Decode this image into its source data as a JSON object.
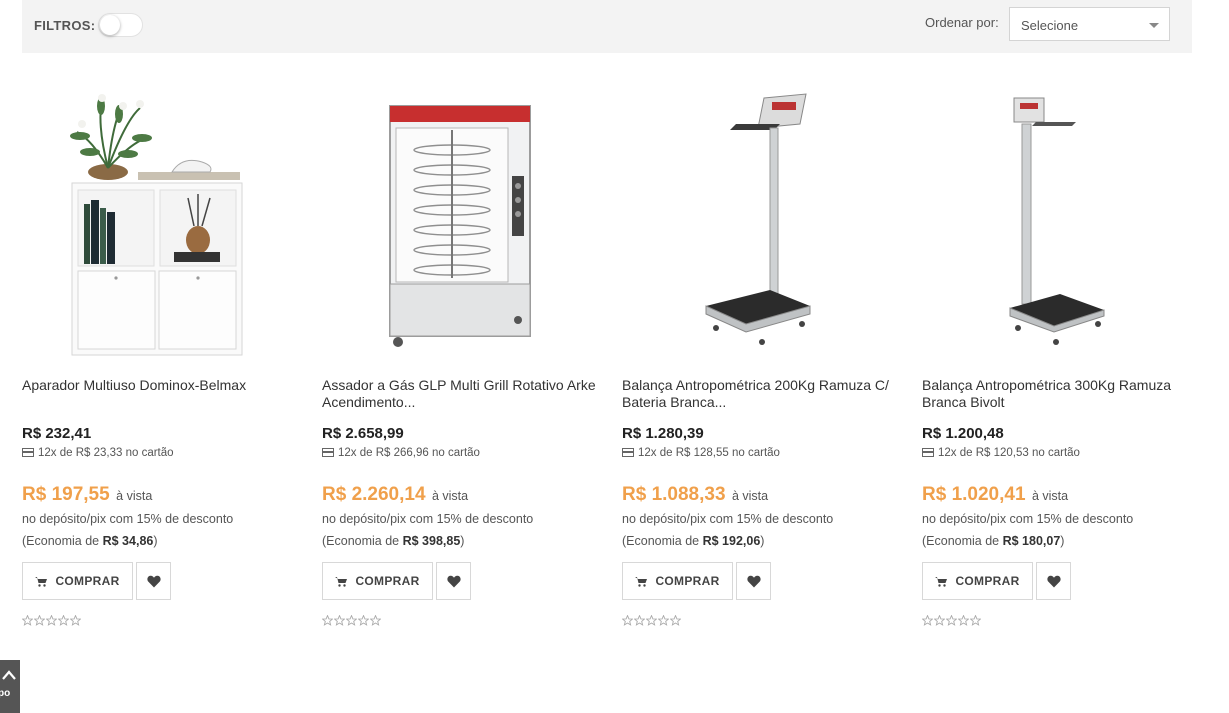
{
  "toolbar": {
    "filters_label": "FILTROS:",
    "sort_label": "Ordenar por:",
    "sort_value": "Selecione"
  },
  "products": [
    {
      "title": "Aparador Multiuso Dominox-Belmax",
      "price": "R$ 232,41",
      "installments": "12x de R$ 23,33 no cartão",
      "cash_price": "R$ 197,55",
      "cash_suffix": "à vista",
      "discount_text": "no depósito/pix com 15% de desconto",
      "economy_prefix": "(Economia de",
      "economy_value": "R$ 34,86",
      "economy_suffix": ")",
      "buy_label": "COMPRAR",
      "rating": 0
    },
    {
      "title": "Assador a Gás GLP Multi Grill Rotativo Arke Acendimento...",
      "price": "R$ 2.658,99",
      "installments": "12x de R$ 266,96 no cartão",
      "cash_price": "R$ 2.260,14",
      "cash_suffix": "à vista",
      "discount_text": "no depósito/pix com 15% de desconto",
      "economy_prefix": "(Economia de",
      "economy_value": "R$ 398,85",
      "economy_suffix": ")",
      "buy_label": "COMPRAR",
      "rating": 0
    },
    {
      "title": "Balança Antropométrica 200Kg Ramuza C/ Bateria Branca...",
      "price": "R$ 1.280,39",
      "installments": "12x de R$ 128,55 no cartão",
      "cash_price": "R$ 1.088,33",
      "cash_suffix": "à vista",
      "discount_text": "no depósito/pix com 15% de desconto",
      "economy_prefix": "(Economia de",
      "economy_value": "R$ 192,06",
      "economy_suffix": ")",
      "buy_label": "COMPRAR",
      "rating": 0
    },
    {
      "title": "Balança Antropométrica 300Kg Ramuza Branca Bivolt",
      "price": "R$ 1.200,48",
      "installments": "12x de R$ 120,53 no cartão",
      "cash_price": "R$ 1.020,41",
      "cash_suffix": "à vista",
      "discount_text": "no depósito/pix com 15% de desconto",
      "economy_prefix": "(Economia de",
      "economy_value": "R$ 180,07",
      "economy_suffix": ")",
      "buy_label": "COMPRAR",
      "rating": 0
    }
  ],
  "back_to_top": {
    "label": "po"
  },
  "colors": {
    "accent_price": "#f0a04b",
    "toolbar_bg": "#f3f3f3"
  }
}
